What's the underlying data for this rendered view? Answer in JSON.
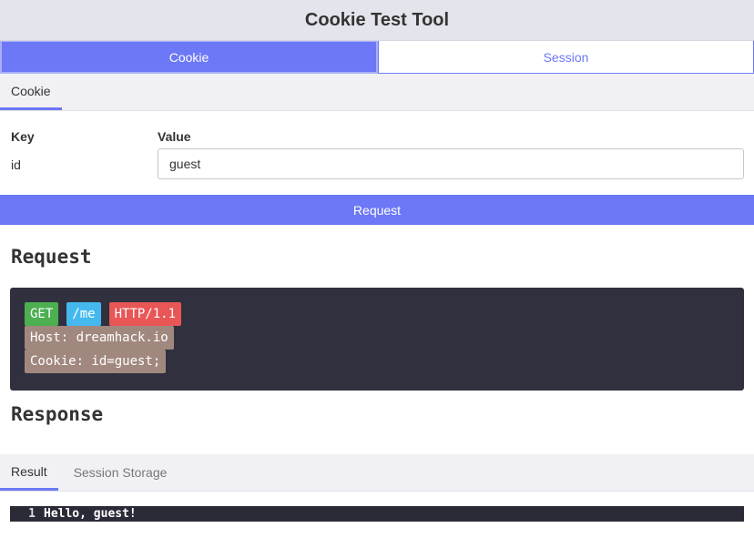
{
  "app": {
    "title": "Cookie Test Tool"
  },
  "main_tabs": [
    {
      "label": "Cookie",
      "active": true
    },
    {
      "label": "Session",
      "active": false
    }
  ],
  "cookie_tab": {
    "label": "Cookie"
  },
  "form": {
    "key_header": "Key",
    "value_header": "Value",
    "key": "id",
    "value": "guest"
  },
  "request_button": {
    "label": "Request"
  },
  "request_section": {
    "title": "Request",
    "method": "GET",
    "path": "/me",
    "protocol": "HTTP/1.1",
    "host_line": "Host: dreamhack.io",
    "cookie_line": "Cookie: id=guest;"
  },
  "response_section": {
    "title": "Response"
  },
  "result_tabs": [
    {
      "label": "Result",
      "active": true
    },
    {
      "label": "Session Storage",
      "active": false
    }
  ],
  "result_editor": {
    "line_number": "1",
    "text": "Hello, guest!"
  },
  "colors": {
    "accent": "#6c78f5",
    "get": "#4caf50",
    "path": "#45b9ee",
    "protocol": "#e95656",
    "header_chip": "#a1887f",
    "code_bg": "#30303e"
  }
}
